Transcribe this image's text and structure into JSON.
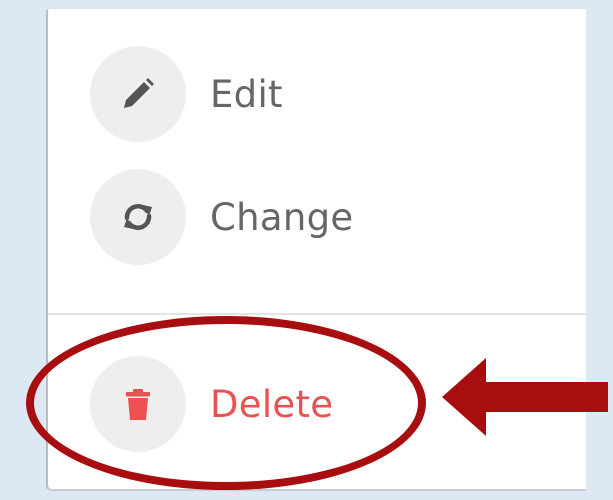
{
  "menu": {
    "items": [
      {
        "id": "edit",
        "label": "Edit",
        "icon": "pencil-icon"
      },
      {
        "id": "change",
        "label": "Change",
        "icon": "refresh-icon"
      },
      {
        "id": "delete",
        "label": "Delete",
        "icon": "trash-icon",
        "destructive": true
      }
    ]
  },
  "annotation": {
    "highlight": "ellipse around delete item",
    "arrow_direction": "left"
  },
  "colors": {
    "background": "#dde8f5",
    "label_text": "#666666",
    "destructive_text": "#ec5151",
    "icon_circle": "#eeeeee",
    "icon_gray": "#555555",
    "annotation_red": "#a80d10"
  }
}
